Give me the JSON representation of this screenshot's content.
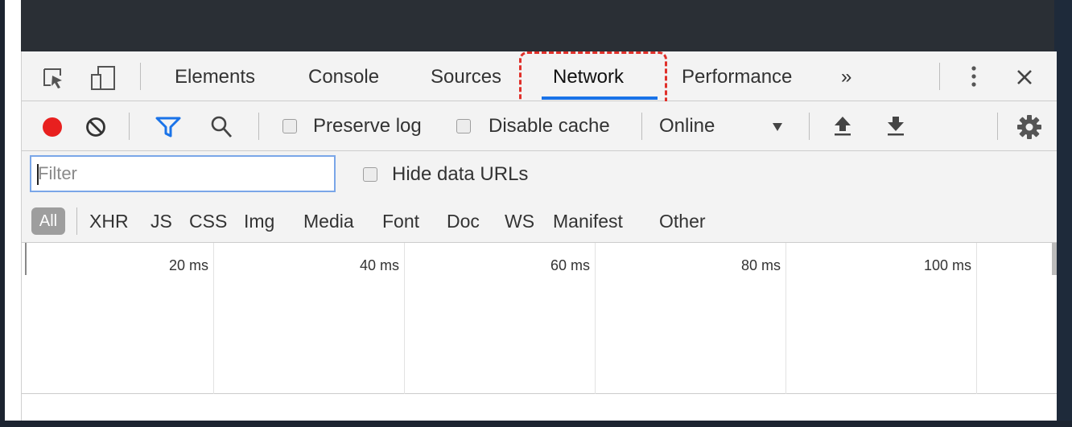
{
  "tabs": {
    "items": [
      {
        "label": "Elements"
      },
      {
        "label": "Console"
      },
      {
        "label": "Sources"
      },
      {
        "label": "Network",
        "active": true
      },
      {
        "label": "Performance"
      }
    ],
    "more": "»"
  },
  "toolbar": {
    "preserve_log": "Preserve log",
    "disable_cache": "Disable cache",
    "throttling": "Online"
  },
  "filter": {
    "placeholder": "Filter",
    "hide_data_urls": "Hide data URLs"
  },
  "types": {
    "all": "All",
    "items": [
      "XHR",
      "JS",
      "CSS",
      "Img",
      "Media",
      "Font",
      "Doc",
      "WS",
      "Manifest",
      "Other"
    ]
  },
  "timeline": {
    "ticks": [
      "20 ms",
      "40 ms",
      "60 ms",
      "80 ms",
      "100 ms"
    ]
  },
  "colors": {
    "record": "#e8201f",
    "filter_icon": "#1a73e8",
    "tab_underline": "#1a73e8",
    "highlight": "#e0302a"
  },
  "icons": [
    "inspect-element-icon",
    "device-toolbar-icon",
    "kebab-menu-icon",
    "close-icon",
    "record-icon",
    "clear-icon",
    "filter-icon",
    "search-icon",
    "dropdown-arrow-icon",
    "import-har-icon",
    "export-har-icon",
    "settings-gear-icon"
  ]
}
